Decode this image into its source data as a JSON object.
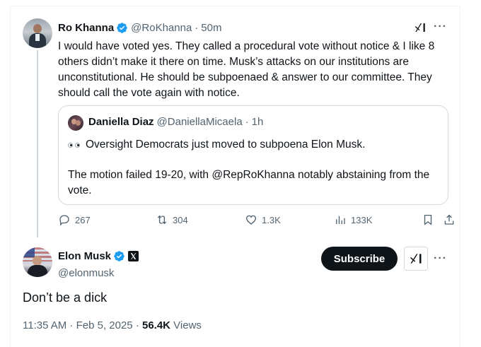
{
  "parent_tweet": {
    "author_name": "Ro Khanna",
    "handle": "@RoKhanna",
    "separator": "·",
    "time": "50m",
    "text": "I would have voted yes. They called a procedural vote without notice & I like 8 others didn’t make it there on time. Musk’s attacks on our institutions are unconstitutional. He should be subpoenaed & answer to our committee. They should call the vote again with notice.",
    "quote": {
      "author_name": "Daniella Diaz",
      "handle": "@DaniellaMicaela",
      "separator": "·",
      "time": "1h",
      "line1": "Oversight Democrats just moved to subpoena Elon Musk.",
      "line2": "The motion failed 19-20, with @RepRoKhanna notably abstaining from the vote."
    },
    "actions": {
      "replies": "267",
      "reposts": "304",
      "likes": "1.3K",
      "views": "133K"
    },
    "icons": [
      "reply-icon",
      "repost-icon",
      "like-icon",
      "views-icon",
      "bookmark-icon",
      "share-icon",
      "grok-icon",
      "more-icon",
      "verified-badge-icon"
    ]
  },
  "main_tweet": {
    "author_name": "Elon Musk",
    "handle": "@elonmusk",
    "subscribe_label": "Subscribe",
    "text": "Don’t be a dick",
    "timestamp": "11:35 AM · Feb 5, 2025 · ",
    "views_count": "56.4K",
    "views_label": " Views"
  },
  "colors": {
    "text": "#0f1419",
    "secondary": "#536471",
    "verified": "#1d9bf0",
    "border": "#cfd9de"
  }
}
